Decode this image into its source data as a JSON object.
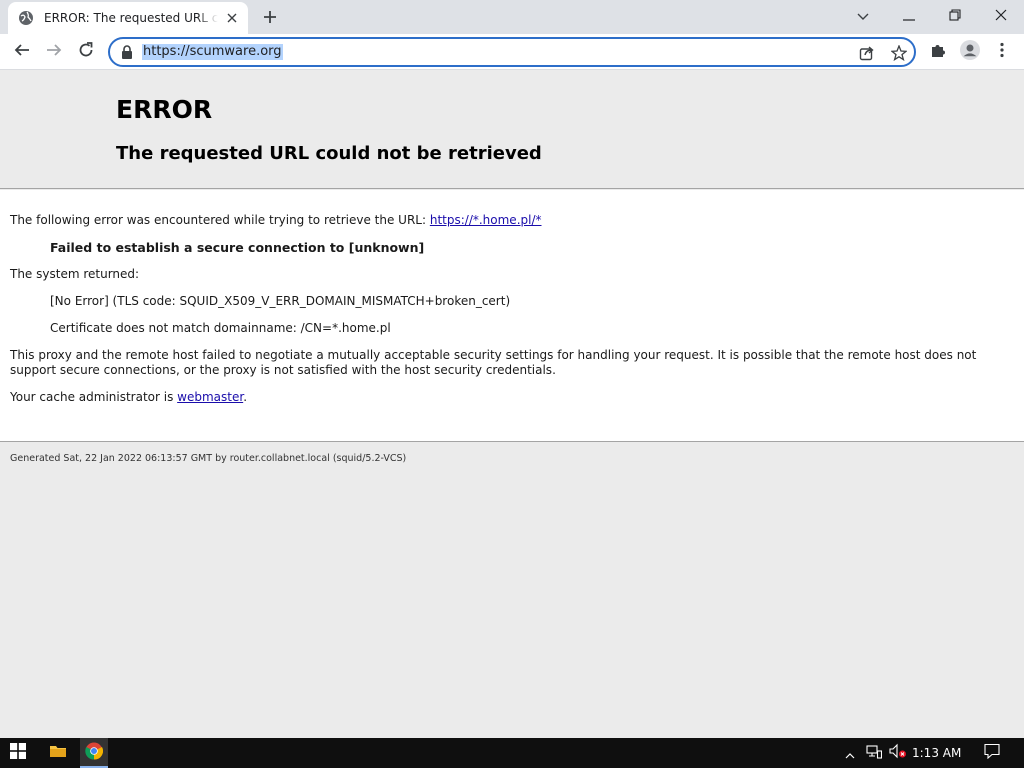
{
  "tab": {
    "title": "ERROR: The requested URL could not be retrieved"
  },
  "omnibox": {
    "url": "https://scumware.org"
  },
  "page": {
    "heading": "ERROR",
    "subheading": "The requested URL could not be retrieved",
    "line1_prefix": "The following error was encountered while trying to retrieve the URL: ",
    "line1_link": "https://*.home.pl/*",
    "failed": "Failed to establish a secure connection to [unknown]",
    "system_returned": "The system returned:",
    "no_error": "[No Error] (TLS code: SQUID_X509_V_ERR_DOMAIN_MISMATCH+broken_cert)",
    "cert_msg": "Certificate does not match domainname: /CN=*.home.pl",
    "proxy_line1": "This proxy and the remote host failed to negotiate a mutually acceptable security settings for handling your request. It is possible that the remote host does not",
    "proxy_line2": "support secure connections, or the proxy is not satisfied with the host security credentials.",
    "admin_prefix": "Your cache administrator is ",
    "admin_link": "webmaster",
    "admin_suffix": ".",
    "footer": "Generated Sat, 22 Jan 2022 06:13:57 GMT by router.collabnet.local (squid/5.2-VCS)"
  },
  "taskbar": {
    "clock": "1:13 AM"
  },
  "icons": {
    "favicon": "globe-icon",
    "close": "close-icon",
    "new_tab": "plus-icon",
    "back": "back-arrow-icon",
    "forward": "forward-arrow-icon",
    "reload": "reload-icon",
    "lock": "lock-icon",
    "share": "share-icon",
    "bookmark": "star-icon",
    "extensions": "puzzle-icon",
    "profile": "profile-icon",
    "menu": "kebab-menu-icon"
  },
  "colors": {
    "omnibox_border": "#2d6ec9",
    "url_highlight": "#b3d3fd",
    "link": "#1a0dab",
    "taskbar": "#0f0f0f"
  }
}
